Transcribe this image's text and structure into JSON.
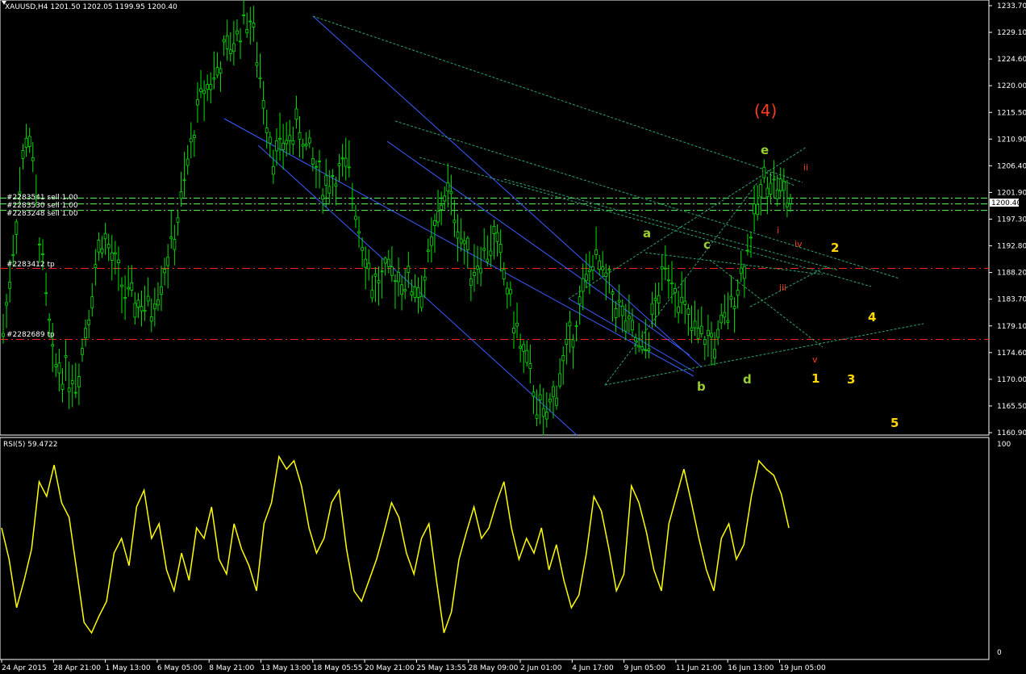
{
  "header": {
    "title": "XAUUSD,H4 1201.50 1202.05 1199.95 1200.40"
  },
  "price_axis": {
    "ticks": [
      "1233.70",
      "1229.10",
      "1224.60",
      "1220.00",
      "1215.50",
      "1210.90",
      "1206.40",
      "1201.90",
      "1197.30",
      "1192.80",
      "1188.20",
      "1183.70",
      "1179.10",
      "1174.60",
      "1170.00",
      "1165.50",
      "1160.90"
    ],
    "current_price": "1200.40"
  },
  "rsi_panel": {
    "title": "RSI(5) 59.4722",
    "tick_top": "100",
    "tick_bottom": "0"
  },
  "time_axis": {
    "labels": [
      "24 Apr 2015",
      "28 Apr 21:00",
      "1 May 13:00",
      "6 May 05:00",
      "8 May 21:00",
      "13 May 13:00",
      "18 May 05:55",
      "20 May 21:00",
      "25 May 13:55",
      "28 May 09:00",
      "2 Jun 01:00",
      "4 Jun 17:00",
      "9 Jun 05:00",
      "11 Jun 21:00",
      "16 Jun 13:00",
      "19 Jun 05:00"
    ]
  },
  "order_labels": {
    "sell1": "#2283541 sell 1.00",
    "sell2": "#2283530 sell 1.00",
    "sell3": "#2283248 sell 1.00",
    "tp1": "#2283412 tp",
    "tp2": "#2282689 tp"
  },
  "wave_labels": {
    "four_paren": "(4)",
    "a": "a",
    "b": "b",
    "c": "c",
    "d": "d",
    "e": "e",
    "r_i": "i",
    "r_ii": "ii",
    "r_iii": "iii",
    "r_iv": "iv",
    "r_v": "v",
    "y1": "1",
    "y2": "2",
    "y3": "3",
    "y4": "4",
    "y5": "5"
  },
  "colors": {
    "background": "#000000",
    "candle": "#00e000",
    "rsi_line": "#ffff00",
    "tp_line": "#ff2020",
    "order_line": "#60ff60",
    "trend_blue": "#3a5cff",
    "trend_green": "#2ea36a",
    "wave_green": "#9acd32",
    "wave_red": "#ff3b1f",
    "wave_yellow": "#ffd700"
  },
  "chart_data": {
    "type": "candlestick",
    "symbol": "XAUUSD",
    "timeframe": "H4",
    "ohlc_last": {
      "open": 1201.5,
      "high": 1202.05,
      "low": 1199.95,
      "close": 1200.4
    },
    "ylim": [
      1160.9,
      1233.7
    ],
    "swing_path": [
      {
        "x": "24 Apr 2015",
        "y": 1178.0
      },
      {
        "x": "27 Apr",
        "y": 1214.0
      },
      {
        "x": "29 Apr",
        "y": 1173.0
      },
      {
        "x": "1 May",
        "y": 1170.0
      },
      {
        "x": "4 May",
        "y": 1195.0
      },
      {
        "x": "6 May",
        "y": 1184.0
      },
      {
        "x": "8 May",
        "y": 1182.0
      },
      {
        "x": "12 May",
        "y": 1195.0
      },
      {
        "x": "13 May",
        "y": 1218.0
      },
      {
        "x": "15 May",
        "y": 1225.0
      },
      {
        "x": "18 May",
        "y": 1232.5
      },
      {
        "x": "20 May",
        "y": 1208.0
      },
      {
        "x": "21 May",
        "y": 1213.0
      },
      {
        "x": "22 May",
        "y": 1203.0
      },
      {
        "x": "25 May",
        "y": 1206.0
      },
      {
        "x": "26 May",
        "y": 1186.0
      },
      {
        "x": "28 May",
        "y": 1188.0
      },
      {
        "x": "29 May",
        "y": 1185.0
      },
      {
        "x": "1 Jun",
        "y": 1203.0
      },
      {
        "x": "2 Jun",
        "y": 1189.0
      },
      {
        "x": "3 Jun",
        "y": 1194.0
      },
      {
        "x": "4 Jun",
        "y": 1176.0
      },
      {
        "x": "5 Jun",
        "y": 1162.0
      },
      {
        "x": "8 Jun",
        "y": 1176.0
      },
      {
        "x": "9 Jun",
        "y": 1191.0
      },
      {
        "x": "10 Jun",
        "y": 1182.0
      },
      {
        "x": "11 Jun",
        "y": 1174.0
      },
      {
        "x": "12 Jun",
        "y": 1190.0
      },
      {
        "x": "15 Jun",
        "y": 1178.0
      },
      {
        "x": "16 Jun",
        "y": 1176.0
      },
      {
        "x": "17 Jun",
        "y": 1188.0
      },
      {
        "x": "18 Jun",
        "y": 1205.0
      },
      {
        "x": "19 Jun",
        "y": 1200.4
      }
    ],
    "rsi": {
      "period": 5,
      "last": 59.4722,
      "ylim": [
        0,
        100
      ],
      "values": [
        60,
        45,
        22,
        35,
        50,
        82,
        75,
        90,
        72,
        65,
        40,
        15,
        10,
        18,
        25,
        48,
        55,
        42,
        70,
        78,
        55,
        62,
        40,
        30,
        48,
        35,
        60,
        55,
        70,
        45,
        38,
        62,
        50,
        42,
        30,
        62,
        72,
        94,
        88,
        92,
        80,
        60,
        48,
        55,
        72,
        78,
        50,
        30,
        25,
        35,
        45,
        58,
        72,
        65,
        48,
        38,
        55,
        62,
        35,
        10,
        20,
        45,
        58,
        70,
        55,
        60,
        72,
        82,
        60,
        45,
        55,
        48,
        60,
        40,
        52,
        35,
        22,
        28,
        48,
        75,
        68,
        50,
        30,
        38,
        80,
        72,
        58,
        40,
        30,
        62,
        75,
        88,
        72,
        55,
        40,
        30,
        55,
        62,
        45,
        52,
        75,
        92,
        88,
        85,
        76,
        60
      ]
    },
    "horizontal_levels": [
      {
        "label": "#2283541 sell 1.00",
        "y": 1200.9
      },
      {
        "label": "#2283530 sell 1.00",
        "y": 1199.9
      },
      {
        "label": "#2283248 sell 1.00",
        "y": 1198.8
      },
      {
        "label": "#2283412 tp",
        "y": 1188.9
      },
      {
        "label": "#2282689 tp",
        "y": 1176.8
      }
    ]
  }
}
